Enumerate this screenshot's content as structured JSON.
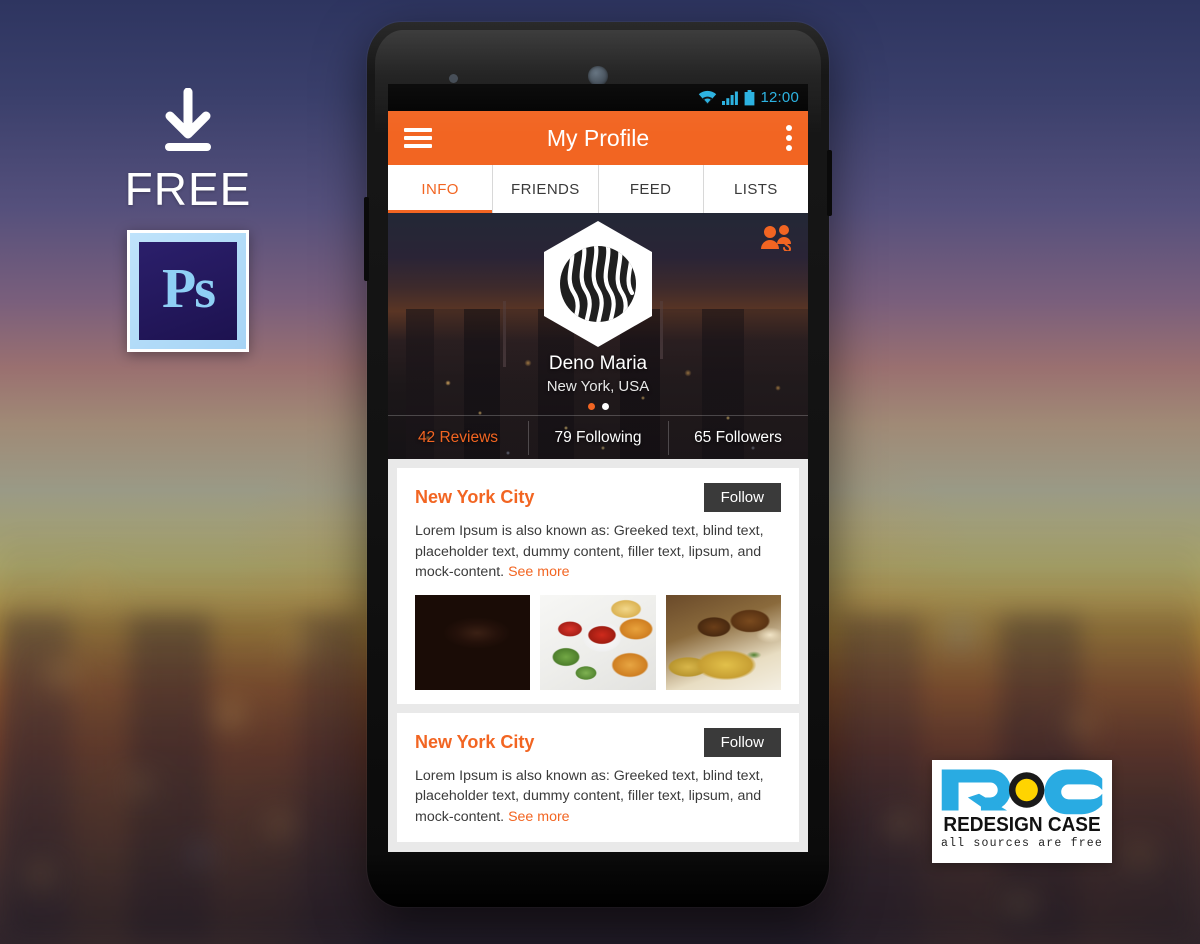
{
  "promo": {
    "download_icon": "download-icon",
    "free_label": "FREE",
    "ps_label": "Ps"
  },
  "logo": {
    "mark_letters": "RC",
    "name": "REDESIGN CASE",
    "tagline": "all sources are free"
  },
  "phone": {
    "statusbar": {
      "wifi_icon": "wifi-icon",
      "signal_icon": "cellular-signal-icon",
      "battery_icon": "battery-icon",
      "time": "12:00",
      "accent_color": "#25b0e0"
    },
    "appbar": {
      "menu_icon": "hamburger-menu-icon",
      "title": "My Profile",
      "overflow_icon": "overflow-menu-icon",
      "bg_color": "#f26522"
    },
    "tabs": [
      {
        "label": "INFO",
        "active": true
      },
      {
        "label": "FRIENDS",
        "active": false
      },
      {
        "label": "FEED",
        "active": false
      },
      {
        "label": "LISTS",
        "active": false
      }
    ],
    "hero": {
      "avatar_icon": "hexagon-wave-avatar",
      "name": "Deno Maria",
      "location": "New York, USA",
      "add_friends_icon": "add-friends-icon",
      "carousel": {
        "total": 2,
        "current": 1
      },
      "stats": [
        {
          "value": "42 Reviews",
          "accent": true
        },
        {
          "value": "79 Following",
          "accent": false
        },
        {
          "value": "65 Followers",
          "accent": false
        }
      ]
    },
    "feed": {
      "cards": [
        {
          "title": "New York City",
          "follow_label": "Follow",
          "body": "Lorem Ipsum is also known as: Greeked text, blind text, placeholder text, dummy content, filler text, lipsum, and mock-content.",
          "see_more_label": "See more",
          "thumbnails": [
            {
              "name": "coffee-cup-photo"
            },
            {
              "name": "fries-nuggets-salad-photo"
            },
            {
              "name": "chicken-biryani-photo"
            }
          ]
        },
        {
          "title": "New York City",
          "follow_label": "Follow",
          "body": "Lorem Ipsum is also known as: Greeked text, blind text, placeholder text, dummy content, filler text, lipsum, and mock-content.",
          "see_more_label": "See more",
          "thumbnails": []
        }
      ]
    }
  },
  "colors": {
    "accent_orange": "#f26522",
    "dark_button": "#3a3a3a",
    "status_blue": "#25b0e0",
    "logo_blue": "#29abe2",
    "logo_yellow": "#ffd400"
  }
}
